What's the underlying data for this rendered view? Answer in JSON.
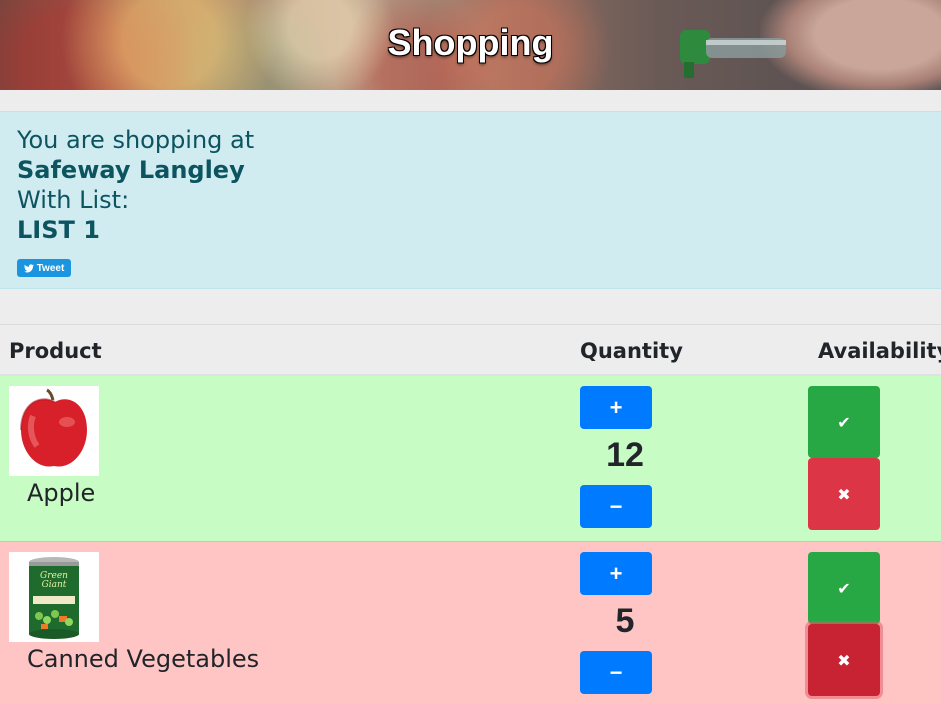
{
  "header": {
    "title": "Shopping"
  },
  "info": {
    "shopping_at_label": "You are shopping at",
    "store_name": "Safeway Langley",
    "list_label": "With List:",
    "list_name": "LIST 1",
    "tweet_label": "Tweet"
  },
  "table": {
    "columns": {
      "product": "Product",
      "quantity": "Quantity",
      "availability": "Availability"
    },
    "rows": [
      {
        "name": "Apple",
        "quantity": "12",
        "status": "available",
        "row_color": "#c8fcc5",
        "image_icon": "apple-image"
      },
      {
        "name": "Canned Vegetables",
        "quantity": "5",
        "status": "unavailable",
        "row_color": "#ffc5c5",
        "image_icon": "canned-vegetables-image"
      }
    ],
    "increment_label": "+",
    "decrement_label": "−",
    "available_icon": "✔",
    "unavailable_icon": "✖"
  },
  "colors": {
    "primary": "#007bff",
    "success": "#28a745",
    "danger": "#dc3545",
    "info_bg": "#d1ecf1",
    "info_text": "#0c5460"
  }
}
